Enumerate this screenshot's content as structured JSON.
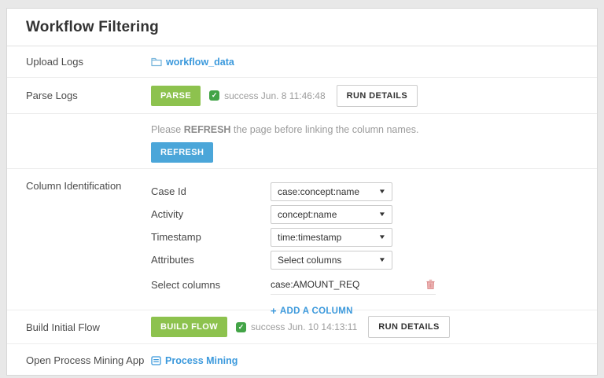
{
  "header": {
    "title": "Workflow Filtering"
  },
  "icons": {
    "caret": "▼",
    "check": "✓",
    "plus": "+"
  },
  "colors": {
    "run_green": "#8dc24e",
    "check_green": "#43a447",
    "refresh_blue": "#4ba6d9",
    "link_blue": "#3b99dc",
    "trash_red": "#dd8f8f"
  },
  "upload": {
    "label": "Upload Logs",
    "link_label": "workflow_data"
  },
  "parse": {
    "label": "Parse Logs",
    "run_button": "PARSE",
    "status": "success Jun. 8 11:46:48",
    "details_button": "RUN DETAILS"
  },
  "refresh_notice": {
    "pre": "Please ",
    "bold": "REFRESH",
    "post": " the page before linking the column names.",
    "button": "REFRESH"
  },
  "column_identification": {
    "label": "Column Identification",
    "fields": [
      {
        "label": "Case Id",
        "value": "case:concept:name"
      },
      {
        "label": "Activity",
        "value": "concept:name"
      },
      {
        "label": "Timestamp",
        "value": "time:timestamp"
      },
      {
        "label": "Attributes",
        "value": "Select columns"
      }
    ],
    "select_columns": {
      "label": "Select columns",
      "value": "case:AMOUNT_REQ"
    },
    "add_column_label": "ADD A COLUMN"
  },
  "build": {
    "label": "Build Initial Flow",
    "run_button": "BUILD FLOW",
    "status": "success Jun. 10 14:13:11",
    "details_button": "RUN DETAILS"
  },
  "open_app": {
    "label": "Open Process Mining App",
    "link_label": "Process Mining"
  }
}
